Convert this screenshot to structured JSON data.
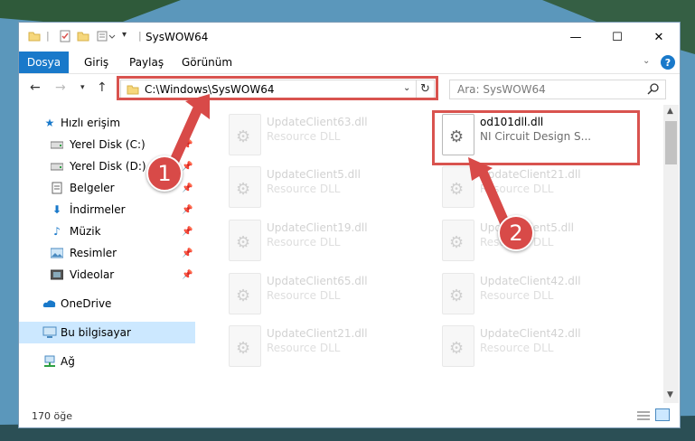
{
  "window": {
    "title": "SysWOW64",
    "controls": {
      "minimize": "—",
      "maximize": "☐",
      "close": "✕"
    }
  },
  "ribbon": {
    "tabs": [
      "Dosya",
      "Giriş",
      "Paylaş",
      "Görünüm"
    ]
  },
  "navigation": {
    "address": "C:\\Windows\\SysWOW64",
    "search_placeholder": "Ara: SysWOW64"
  },
  "sidebar": {
    "items": [
      {
        "label": "Hızlı erişim",
        "icon": "star-icon"
      },
      {
        "label": "Yerel Disk (C:)",
        "icon": "drive-icon",
        "pinned": true
      },
      {
        "label": "Yerel Disk (D:)",
        "icon": "drive-icon",
        "pinned": true
      },
      {
        "label": "Belgeler",
        "icon": "documents-icon",
        "pinned": true
      },
      {
        "label": "İndirmeler",
        "icon": "download-icon",
        "pinned": true
      },
      {
        "label": "Müzik",
        "icon": "music-icon",
        "pinned": true
      },
      {
        "label": "Resimler",
        "icon": "pictures-icon",
        "pinned": true
      },
      {
        "label": "Videolar",
        "icon": "videos-icon",
        "pinned": true
      },
      {
        "label": "OneDrive",
        "icon": "cloud-icon"
      },
      {
        "label": "Bu bilgisayar",
        "icon": "computer-icon",
        "selected": true
      },
      {
        "label": "Ağ",
        "icon": "network-icon"
      }
    ]
  },
  "files": [
    {
      "name": "UpdateClient63.dll",
      "type": "Resource DLL"
    },
    {
      "name": "od101dll.dll",
      "type": "NI Circuit Design S...",
      "highlighted": true
    },
    {
      "name": "UpdateClient5.dll",
      "type": "Resource DLL"
    },
    {
      "name": "UpdateClient21.dll",
      "type": "Resource DLL"
    },
    {
      "name": "UpdateClient19.dll",
      "type": "Resource DLL"
    },
    {
      "name": "UpdateClient5.dll",
      "type": "Resource DLL"
    },
    {
      "name": "UpdateClient65.dll",
      "type": "Resource DLL"
    },
    {
      "name": "UpdateClient42.dll",
      "type": "Resource DLL"
    },
    {
      "name": "UpdateClient21.dll",
      "type": "Resource DLL"
    },
    {
      "name": "UpdateClient42.dll",
      "type": "Resource DLL"
    }
  ],
  "status": {
    "item_count": "170 öğe"
  },
  "annotations": {
    "badge1": "1",
    "badge2": "2",
    "color": "#d9534f"
  }
}
